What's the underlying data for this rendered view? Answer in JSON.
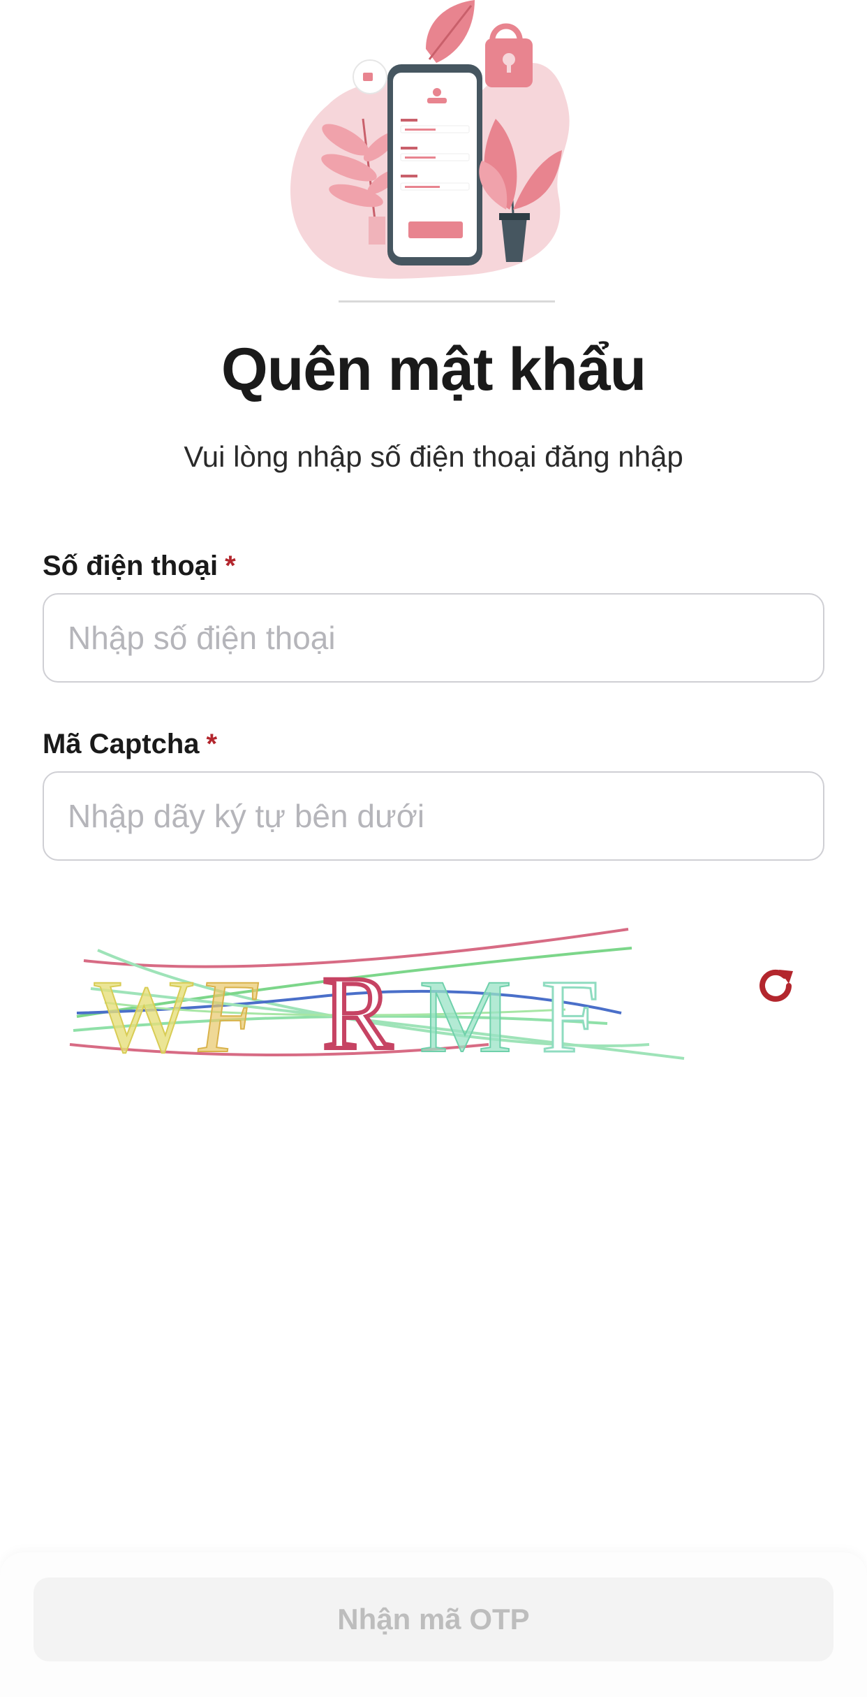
{
  "header": {
    "title": "Quên mật khẩu",
    "subtitle": "Vui lòng nhập số điện thoại đăng nhập"
  },
  "form": {
    "phone": {
      "label": "Số điện thoại",
      "required_mark": "*",
      "placeholder": "Nhập số điện thoại",
      "value": ""
    },
    "captcha": {
      "label": "Mã Captcha",
      "required_mark": "*",
      "placeholder": "Nhập dãy ký tự bên dưới",
      "value": "",
      "image_text": "WFRMF",
      "refresh_icon": "refresh-icon"
    }
  },
  "footer": {
    "submit_label": "Nhận mã OTP",
    "submit_enabled": false
  },
  "colors": {
    "accent": "#b3262d",
    "illustration_pink": "#e8848f",
    "illustration_light": "#f6d6da",
    "dark": "#465660",
    "disabled_text": "#bdbdbd",
    "disabled_bg": "#f3f3f3"
  }
}
